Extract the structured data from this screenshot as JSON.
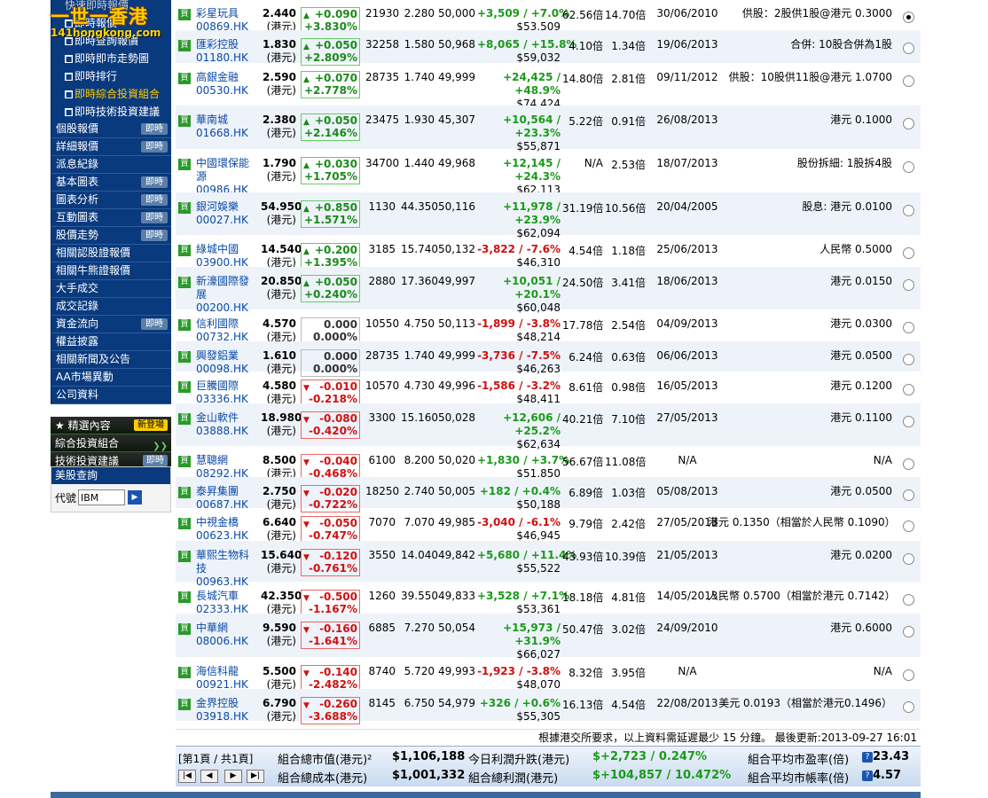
{
  "logo": {
    "line1": "一世一香港",
    "line2": "141hongkong.com"
  },
  "sidebar": {
    "top_cut": "快速即時報價",
    "subs": [
      {
        "label": "即時報價",
        "hl": false
      },
      {
        "label": "即時查詢報價",
        "hl": false
      },
      {
        "label": "即時即市走勢圖",
        "hl": false
      },
      {
        "label": "即時排行",
        "hl": false
      },
      {
        "label": "即時綜合投資組合",
        "hl": true
      },
      {
        "label": "即時技術投資建議",
        "hl": false
      }
    ],
    "mains": [
      {
        "label": "個股報價",
        "tag": "即時"
      },
      {
        "label": "詳細報價",
        "tag": "即時"
      },
      {
        "label": "派息紀錄",
        "tag": ""
      },
      {
        "label": "基本圖表",
        "tag": "即時"
      },
      {
        "label": "圖表分析",
        "tag": "即時"
      },
      {
        "label": "互動圖表",
        "tag": "即時"
      },
      {
        "label": "股價走勢",
        "tag": "即時"
      },
      {
        "label": "相關認股證報價",
        "tag": ""
      },
      {
        "label": "相關牛熊證報價",
        "tag": ""
      },
      {
        "label": "大手成交",
        "tag": ""
      },
      {
        "label": "成交記錄",
        "tag": ""
      },
      {
        "label": "資金流向",
        "tag": "即時"
      },
      {
        "label": "權益披露",
        "tag": ""
      },
      {
        "label": "相關新聞及公告",
        "tag": ""
      },
      {
        "label": "AA市場異動",
        "tag": ""
      },
      {
        "label": "公司資料",
        "tag": ""
      }
    ],
    "green_items": [
      {
        "label": "★ 精選內容",
        "tag": "新登場",
        "tagtype": "new"
      },
      {
        "label": "綜合投資組合",
        "tag": "",
        "tagtype": "arr"
      },
      {
        "label": "技術投資建議",
        "tag": "即時",
        "tagtype": "now"
      }
    ],
    "us_quote": {
      "title": "美股查詢",
      "code_label": "代號",
      "code_value": "IBM"
    }
  },
  "rows": [
    {
      "name": "彩星玩具",
      "code": "00869.HK",
      "price": "2.440",
      "unit": "(港元)",
      "dir": "up",
      "chg": "+0.090",
      "pct": "+3.830%",
      "vol": "21930",
      "cost": "2.280",
      "mv": "50,000",
      "pl": "+3,509 / +7.0%",
      "pl2": "",
      "total": "$53,509",
      "pe": "62.56倍",
      "pb": "14.70倍",
      "date": "30/06/2010",
      "event": "供股：2股供1股@港元 0.3000",
      "checked": true
    },
    {
      "name": "匯彩控股",
      "code": "01180.HK",
      "price": "1.830",
      "unit": "(港元)",
      "dir": "up",
      "chg": "+0.050",
      "pct": "+2.809%",
      "vol": "32258",
      "cost": "1.580",
      "mv": "50,968",
      "pl": "+8,065 / +15.8%",
      "pl2": "",
      "total": "$59,032",
      "pe": "4.10倍",
      "pb": "1.34倍",
      "date": "19/06/2013",
      "event": "合併: 10股合併為1股",
      "checked": false
    },
    {
      "name": "高銀金融",
      "code": "00530.HK",
      "price": "2.590",
      "unit": "(港元)",
      "dir": "up",
      "chg": "+0.070",
      "pct": "+2.778%",
      "vol": "28735",
      "cost": "1.740",
      "mv": "49,999",
      "pl": "+24,425 /",
      "pl2": "+48.9%",
      "total": "$74,424",
      "pe": "14.80倍",
      "pb": "2.81倍",
      "date": "09/11/2012",
      "event": "供股：10股供11股@港元 1.0700",
      "checked": false
    },
    {
      "name": "華南城",
      "code": "01668.HK",
      "price": "2.380",
      "unit": "(港元)",
      "dir": "up",
      "chg": "+0.050",
      "pct": "+2.146%",
      "vol": "23475",
      "cost": "1.930",
      "mv": "45,307",
      "pl": "+10,564 /",
      "pl2": "+23.3%",
      "total": "$55,871",
      "pe": "5.22倍",
      "pb": "0.91倍",
      "date": "26/08/2013",
      "event": "港元 0.1000",
      "checked": false
    },
    {
      "name": "中國環保能源",
      "code": "00986.HK",
      "price": "1.790",
      "unit": "(港元)",
      "dir": "up",
      "chg": "+0.030",
      "pct": "+1.705%",
      "vol": "34700",
      "cost": "1.440",
      "mv": "49,968",
      "pl": "+12,145 /",
      "pl2": "+24.3%",
      "total": "$62,113",
      "pe": "N/A",
      "pb": "2.53倍",
      "date": "18/07/2013",
      "event": "股份拆細: 1股拆4股",
      "checked": false
    },
    {
      "name": "銀河娛樂",
      "code": "00027.HK",
      "price": "54.950",
      "unit": "(港元)",
      "dir": "up",
      "chg": "+0.850",
      "pct": "+1.571%",
      "vol": "1130",
      "cost": "44.350",
      "mv": "50,116",
      "pl": "+11,978 /",
      "pl2": "+23.9%",
      "total": "$62,094",
      "pe": "31.19倍",
      "pb": "10.56倍",
      "date": "20/04/2005",
      "event": "股息: 港元 0.0100",
      "checked": false
    },
    {
      "name": "綠城中國",
      "code": "03900.HK",
      "price": "14.540",
      "unit": "(港元)",
      "dir": "up",
      "chg": "+0.200",
      "pct": "+1.395%",
      "vol": "3185",
      "cost": "15.740",
      "mv": "50,132",
      "pl": "-3,822 / -7.6%",
      "pl2": "",
      "total": "$46,310",
      "pe": "4.54倍",
      "pb": "1.18倍",
      "date": "25/06/2013",
      "event": "人民幣 0.5000",
      "checked": false
    },
    {
      "name": "新濠國際發展",
      "code": "00200.HK",
      "price": "20.850",
      "unit": "(港元)",
      "dir": "up",
      "chg": "+0.050",
      "pct": "+0.240%",
      "vol": "2880",
      "cost": "17.360",
      "mv": "49,997",
      "pl": "+10,051 /",
      "pl2": "+20.1%",
      "total": "$60,048",
      "pe": "24.50倍",
      "pb": "3.41倍",
      "date": "18/06/2013",
      "event": "港元 0.0150",
      "checked": false
    },
    {
      "name": "信利國際",
      "code": "00732.HK",
      "price": "4.570",
      "unit": "(港元)",
      "dir": "eq",
      "chg": "0.000",
      "pct": "0.000%",
      "vol": "10550",
      "cost": "4.750",
      "mv": "50,113",
      "pl": "-1,899 / -3.8%",
      "pl2": "",
      "total": "$48,214",
      "pe": "17.78倍",
      "pb": "2.54倍",
      "date": "04/09/2013",
      "event": "港元 0.0300",
      "checked": false
    },
    {
      "name": "興發鋁業",
      "code": "00098.HK",
      "price": "1.610",
      "unit": "(港元)",
      "dir": "eq",
      "chg": "0.000",
      "pct": "0.000%",
      "vol": "28735",
      "cost": "1.740",
      "mv": "49,999",
      "pl": "-3,736 / -7.5%",
      "pl2": "",
      "total": "$46,263",
      "pe": "6.24倍",
      "pb": "0.63倍",
      "date": "06/06/2013",
      "event": "港元 0.0500",
      "checked": false
    },
    {
      "name": "巨騰國際",
      "code": "03336.HK",
      "price": "4.580",
      "unit": "(港元)",
      "dir": "dn",
      "chg": "-0.010",
      "pct": "-0.218%",
      "vol": "10570",
      "cost": "4.730",
      "mv": "49,996",
      "pl": "-1,586 / -3.2%",
      "pl2": "",
      "total": "$48,411",
      "pe": "8.61倍",
      "pb": "0.98倍",
      "date": "16/05/2013",
      "event": "港元 0.1200",
      "checked": false
    },
    {
      "name": "金山軟件",
      "code": "03888.HK",
      "price": "18.980",
      "unit": "(港元)",
      "dir": "dn",
      "chg": "-0.080",
      "pct": "-0.420%",
      "vol": "3300",
      "cost": "15.160",
      "mv": "50,028",
      "pl": "+12,606 /",
      "pl2": "+25.2%",
      "total": "$62,634",
      "pe": "40.21倍",
      "pb": "7.10倍",
      "date": "27/05/2013",
      "event": "港元 0.1100",
      "checked": false
    },
    {
      "name": "慧聰網",
      "code": "08292.HK",
      "price": "8.500",
      "unit": "(港元)",
      "dir": "dn",
      "chg": "-0.040",
      "pct": "-0.468%",
      "vol": "6100",
      "cost": "8.200",
      "mv": "50,020",
      "pl": "+1,830 / +3.7%",
      "pl2": "",
      "total": "$51,850",
      "pe": "56.67倍",
      "pb": "11.08倍",
      "date": "N/A",
      "event": "N/A",
      "checked": false
    },
    {
      "name": "泰昇集團",
      "code": "00687.HK",
      "price": "2.750",
      "unit": "(港元)",
      "dir": "dn",
      "chg": "-0.020",
      "pct": "-0.722%",
      "vol": "18250",
      "cost": "2.740",
      "mv": "50,005",
      "pl": "+182 / +0.4%",
      "pl2": "",
      "total": "$50,188",
      "pe": "6.89倍",
      "pb": "1.03倍",
      "date": "05/08/2013",
      "event": "港元 0.0500",
      "checked": false
    },
    {
      "name": "中視金橋",
      "code": "00623.HK",
      "price": "6.640",
      "unit": "(港元)",
      "dir": "dn",
      "chg": "-0.050",
      "pct": "-0.747%",
      "vol": "7070",
      "cost": "7.070",
      "mv": "49,985",
      "pl": "-3,040 / -6.1%",
      "pl2": "",
      "total": "$46,945",
      "pe": "9.79倍",
      "pb": "2.42倍",
      "date": "27/05/2013",
      "event": "港元 0.1350（相當於人民幣 0.1090）",
      "checked": false
    },
    {
      "name": "華熙生物科技",
      "code": "00963.HK",
      "price": "15.640",
      "unit": "(港元)",
      "dir": "dn",
      "chg": "-0.120",
      "pct": "-0.761%",
      "vol": "3550",
      "cost": "14.040",
      "mv": "49,842",
      "pl": "+5,680 / +11.4%",
      "pl2": "",
      "total": "$55,522",
      "pe": "43.93倍",
      "pb": "10.39倍",
      "date": "21/05/2013",
      "event": "港元 0.0200",
      "checked": false
    },
    {
      "name": "長城汽車",
      "code": "02333.HK",
      "price": "42.350",
      "unit": "(港元)",
      "dir": "dn",
      "chg": "-0.500",
      "pct": "-1.167%",
      "vol": "1260",
      "cost": "39.550",
      "mv": "49,833",
      "pl": "+3,528 / +7.1%",
      "pl2": "",
      "total": "$53,361",
      "pe": "18.18倍",
      "pb": "4.81倍",
      "date": "14/05/2013",
      "event": "人民幣 0.5700（相當於港元 0.7142）",
      "checked": false
    },
    {
      "name": "中華網",
      "code": "08006.HK",
      "price": "9.590",
      "unit": "(港元)",
      "dir": "dn",
      "chg": "-0.160",
      "pct": "-1.641%",
      "vol": "6885",
      "cost": "7.270",
      "mv": "50,054",
      "pl": "+15,973 /",
      "pl2": "+31.9%",
      "total": "$66,027",
      "pe": "50.47倍",
      "pb": "3.02倍",
      "date": "24/09/2010",
      "event": "港元 0.6000",
      "checked": false
    },
    {
      "name": "海信科龍",
      "code": "00921.HK",
      "price": "5.500",
      "unit": "(港元)",
      "dir": "dn",
      "chg": "-0.140",
      "pct": "-2.482%",
      "vol": "8740",
      "cost": "5.720",
      "mv": "49,993",
      "pl": "-1,923 / -3.8%",
      "pl2": "",
      "total": "$48,070",
      "pe": "8.32倍",
      "pb": "3.95倍",
      "date": "N/A",
      "event": "N/A",
      "checked": false
    },
    {
      "name": "金界控股",
      "code": "03918.HK",
      "price": "6.790",
      "unit": "(港元)",
      "dir": "dn",
      "chg": "-0.260",
      "pct": "-3.688%",
      "vol": "8145",
      "cost": "6.750",
      "mv": "54,979",
      "pl": "+326 / +0.6%",
      "pl2": "",
      "total": "$55,305",
      "pe": "16.13倍",
      "pb": "4.54倍",
      "date": "22/08/2013",
      "event": "美元 0.0193（相當於港元0.1496）",
      "checked": false
    }
  ],
  "footnote": "根據港交所要求，以上資料需延遲最少 15 分鐘。 最後更新:2013-09-27 16:01",
  "summary": {
    "page": "[第1頁 / 共1頁]",
    "mv_label": "組合總市值(港元)²",
    "mv_value": "$1,106,188",
    "cost_label": "組合總成本(港元)",
    "cost_value": "$1,001,332",
    "dpl_label": "今日利潤升跌(港元)",
    "dpl_value": "$+2,723 / 0.247%",
    "tpl_label": "組合總利潤(港元)",
    "tpl_value": "$+104,857 / 10.472%",
    "pe_label": "組合平均市盈率(倍)",
    "pe_value": "23.43",
    "pb_label": "組合平均市帳率(倍)",
    "pb_value": "4.57"
  }
}
